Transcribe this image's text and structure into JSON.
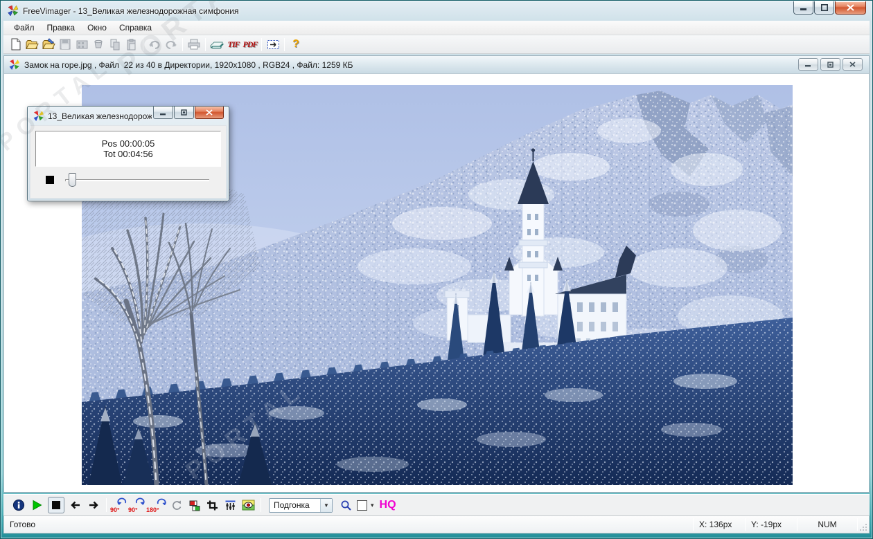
{
  "app": {
    "title": "FreeVimager - 13_Великая железнодорожная симфония"
  },
  "menu": {
    "items": [
      {
        "label": "Файл"
      },
      {
        "label": "Правка"
      },
      {
        "label": "Окно"
      },
      {
        "label": "Справка"
      }
    ]
  },
  "toolbar": {
    "icons": [
      "new-file",
      "open-folder",
      "open-folder-edit",
      "save",
      "film",
      "export",
      "copy",
      "paste",
      "undo",
      "redo",
      "print",
      "scan",
      "tif",
      "pdf",
      "email",
      "help"
    ],
    "tif_label": "TIF",
    "pdf_label": "PDF",
    "help_label": "?"
  },
  "image_window": {
    "title": "Замок на горе.jpg , Файл  22 из 40 в Директории, 1920x1080 , RGB24 , Файл: 1259 КБ",
    "photo_description": "Neuschwanstein castle on a snowy forested mountain in winter, bare tree at left, snow-covered firs in foreground"
  },
  "player": {
    "title": "13_Великая железнодорож...",
    "position": "Pos 00:00:05",
    "total": "Tot 00:04:56",
    "slider_percent": 4
  },
  "viewer_toolbar": {
    "rotate_left_label": "90°",
    "rotate_right_label": "90°",
    "rotate_180_label": "180°",
    "fit_mode": "Подгонка",
    "hq_label": "HQ",
    "dropdown_arrow": "▼",
    "bg_caret": "▾"
  },
  "status_bar": {
    "message": "Готово",
    "x": "X: 136px",
    "y": "Y: -19px",
    "keypad": "NUM"
  },
  "watermark": {
    "text": "PORTAL"
  },
  "colors": {
    "accent_teal": "#3aa4ad",
    "close_button": "#d2572f",
    "hq_magenta": "#f000d0",
    "rotate_red": "#dd1111",
    "play_green": "#00c400",
    "info_blue": "#15357e"
  }
}
